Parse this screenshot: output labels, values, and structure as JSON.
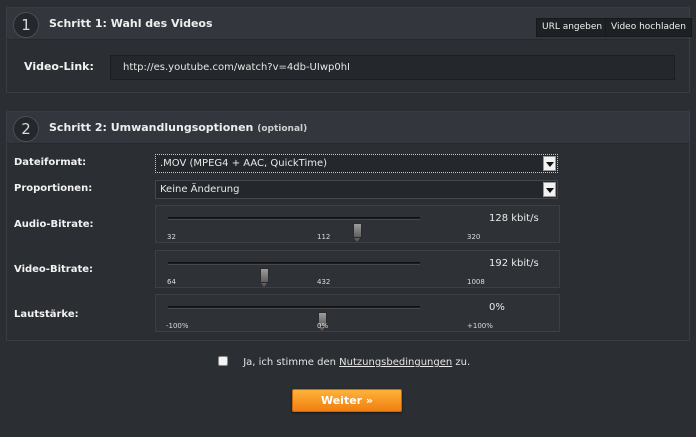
{
  "step1": {
    "number": "1",
    "title": "Schritt 1: Wahl des Videos",
    "url_button": "URL angeben",
    "upload_button": "Video hochladen",
    "link_label": "Video-Link:",
    "link_value": "http://es.youtube.com/watch?v=4db-UIwp0hI"
  },
  "step2": {
    "number": "2",
    "title": "Schritt 2: Umwandlungsoptionen",
    "title_note": "(optional)",
    "format": {
      "label": "Dateiformat:",
      "selected": ".MOV (MPEG4 + AAC, QuickTime)"
    },
    "proportions": {
      "label": "Proportionen:",
      "selected": "Keine Änderung"
    },
    "audio": {
      "label": "Audio-Bitrate:",
      "value_text": "128 kbit/s",
      "min": "32",
      "mid": "112",
      "max": "320",
      "position": 0.75
    },
    "video": {
      "label": "Video-Bitrate:",
      "value_text": "192 kbit/s",
      "min": "64",
      "mid": "432",
      "max": "1008",
      "position": 0.38
    },
    "volume": {
      "label": "Lautstärke:",
      "value_text": "0%",
      "min": "-100%",
      "mid": "0%",
      "max": "+100%",
      "position": 0.61
    }
  },
  "terms": {
    "prefix": "Ja, ich stimme den",
    "link": "Nutzungsbedingungen",
    "suffix": "zu."
  },
  "submit_label": "Weiter »"
}
